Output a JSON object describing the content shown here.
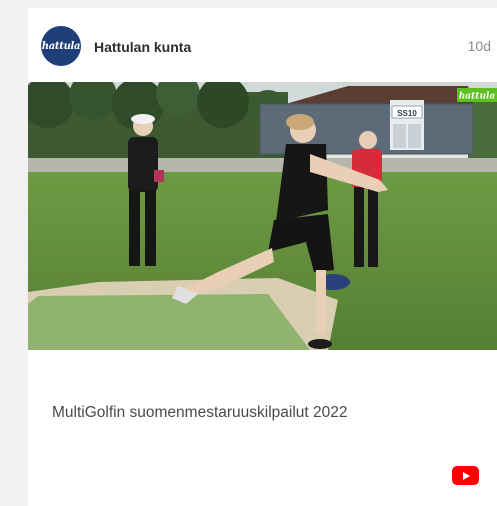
{
  "post": {
    "account_name": "Hattulan kunta",
    "avatar_text": "hattula",
    "time_ago": "10d",
    "caption": "MultiGolfin suomenmestaruuskilpailut 2022"
  },
  "media": {
    "watermark": "hattula",
    "building_sign": "SS10"
  },
  "icons": {
    "play_platform": "youtube-icon"
  },
  "colors": {
    "avatar_bg": "#1f3f7a",
    "youtube_red": "#ff0000",
    "watermark_green": "#5cc11f"
  }
}
